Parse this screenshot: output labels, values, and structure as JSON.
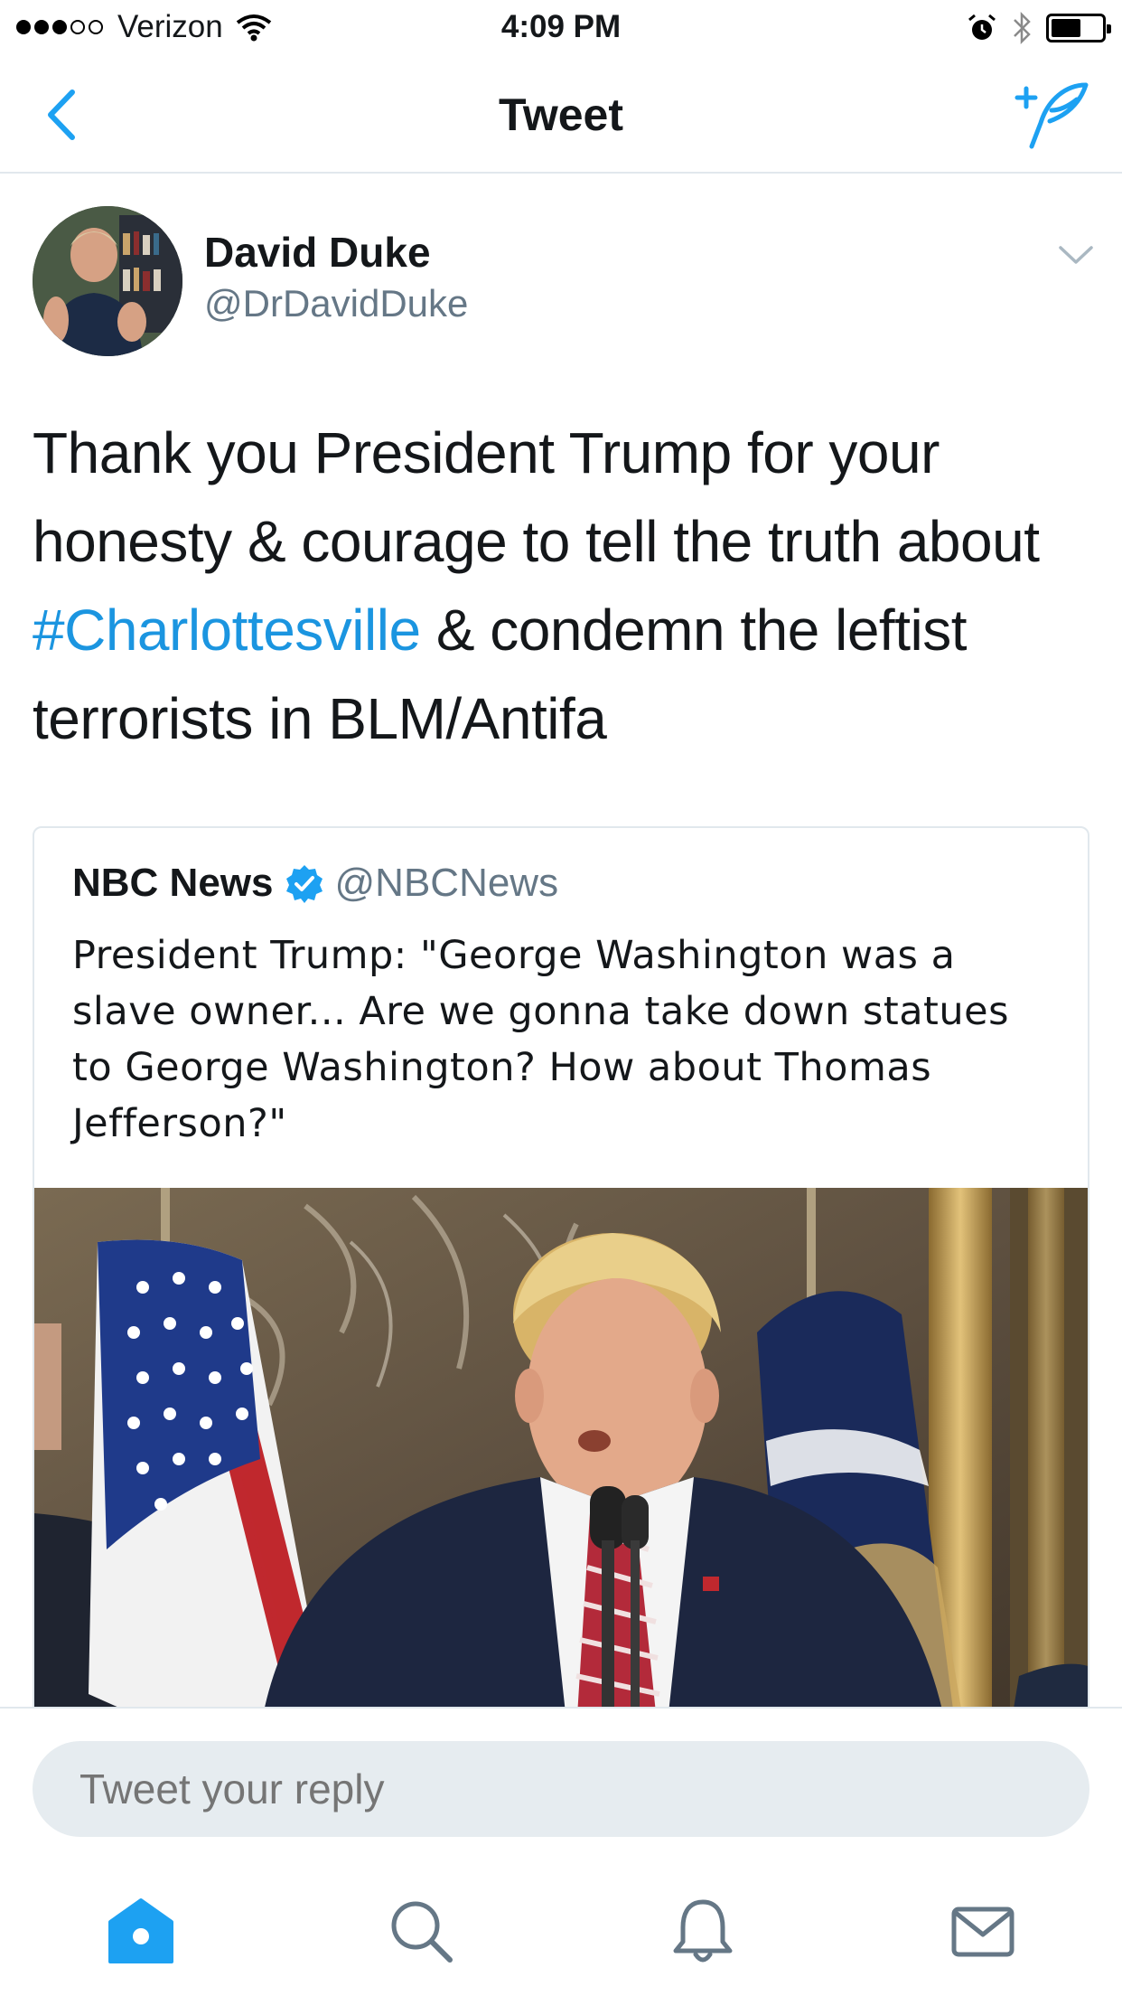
{
  "status_bar": {
    "carrier": "Verizon",
    "time": "4:09 PM",
    "signal_bars_filled": 3,
    "signal_bars_total": 5,
    "battery_level": 0.6
  },
  "nav": {
    "title": "Tweet",
    "back_icon": "chevron-left-icon",
    "compose_icon": "compose-tweet-icon"
  },
  "tweet": {
    "author_name": "David Duke",
    "author_handle": "@DrDavidDuke",
    "text_part1": "Thank you President Trump for your honesty & courage to tell the truth about",
    "hashtag": "#Charlottesville",
    "text_part2": " & condemn the leftist terrorists in BLM/Antifa"
  },
  "quoted_tweet": {
    "author_name": "NBC News",
    "author_handle": "@NBCNews",
    "verified": true,
    "text": "President Trump: \"George Washington was a slave owner... Are we gonna take down statues to George Washington? How about Thomas Jefferson?\""
  },
  "reply": {
    "placeholder": "Tweet your reply"
  },
  "tabs": [
    {
      "name": "home",
      "icon": "home-icon",
      "active": true
    },
    {
      "name": "search",
      "icon": "search-icon",
      "active": false
    },
    {
      "name": "notifications",
      "icon": "bell-icon",
      "active": false
    },
    {
      "name": "messages",
      "icon": "envelope-icon",
      "active": false
    }
  ],
  "colors": {
    "accent": "#1da1f2",
    "hashtag": "#1b95e0",
    "secondary_text": "#657786",
    "divider": "#e1e8ed",
    "input_bg": "#e6ecf0"
  }
}
